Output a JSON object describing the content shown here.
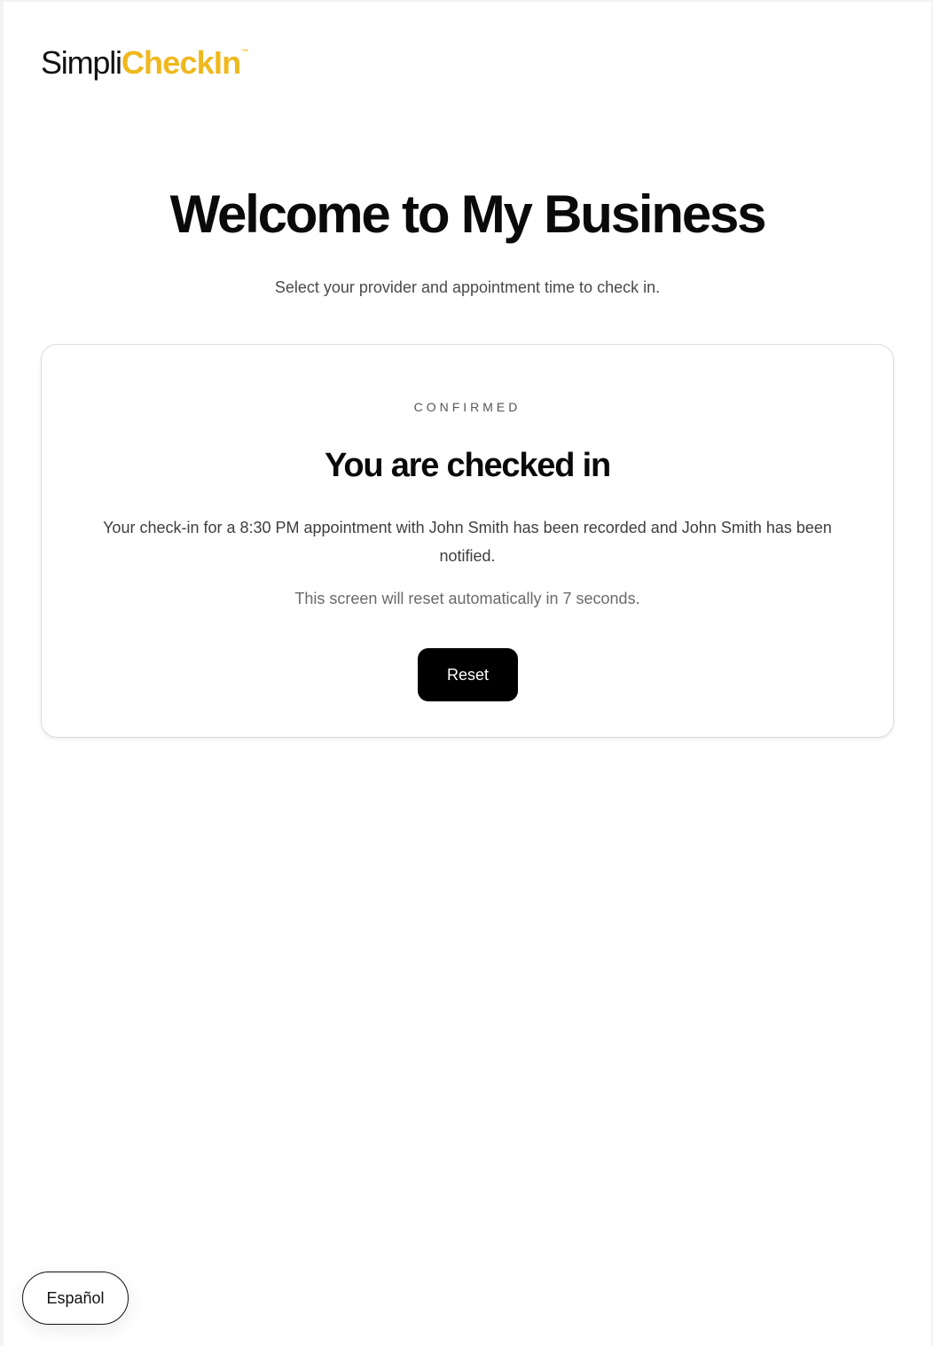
{
  "brand": {
    "name_part1": "Simpli",
    "name_part2": "CheckIn",
    "trademark": "™",
    "accent_color": "#efb81c"
  },
  "header": {
    "title": "Welcome to My Business",
    "subtitle": "Select your provider and appointment time to check in."
  },
  "confirmation": {
    "status_label": "CONFIRMED",
    "title": "You are checked in",
    "message": "Your check-in for a 8:30 PM appointment with John Smith has been recorded and John Smith has been notified.",
    "countdown": "This screen will reset automatically in 7 seconds.",
    "reset_label": "Reset"
  },
  "language_toggle": {
    "label": "Español"
  }
}
